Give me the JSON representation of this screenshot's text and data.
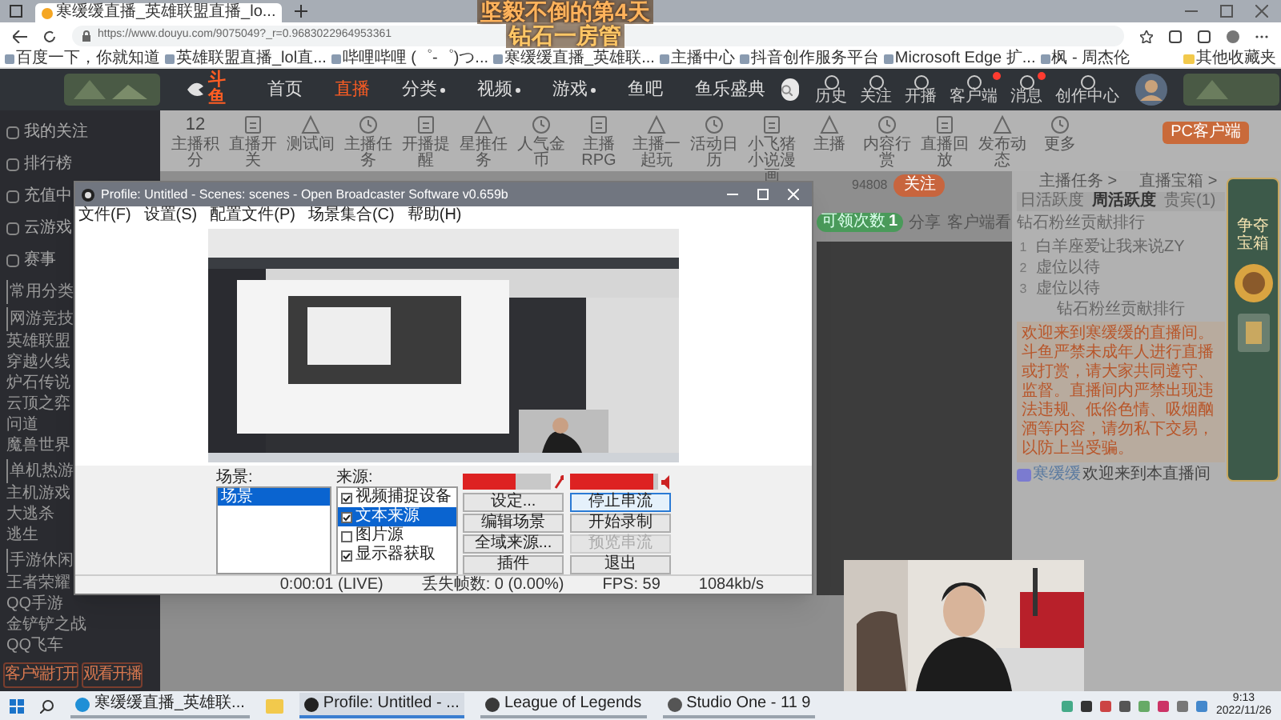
{
  "stream_overlay": [
    "坚毅不倒的第4天",
    "钻石一房管"
  ],
  "browser": {
    "tab_title": "寒缓缓直播_英雄联盟直播_lo...",
    "url": "https://www.douyu.com/9075049?_r=0.9683022964953361",
    "bookmarks": [
      "百度一下，你就知道",
      "英雄联盟直播_lol直...",
      "哔哩哔哩 (゜-゜)つ...",
      "寒缓缓直播_英雄联...",
      "主播中心",
      "抖音创作服务平台",
      "Microsoft Edge 扩...",
      "枫 - 周杰伦"
    ],
    "other_bookmarks": "其他收藏夹"
  },
  "site": {
    "logo": "斗鱼",
    "nav": [
      {
        "label": "首页",
        "selected": false,
        "has_menu": false
      },
      {
        "label": "直播",
        "selected": true,
        "has_menu": false
      },
      {
        "label": "分类",
        "selected": false,
        "has_menu": true
      },
      {
        "label": "视频",
        "selected": false,
        "has_menu": true
      },
      {
        "label": "游戏",
        "selected": false,
        "has_menu": true
      },
      {
        "label": "鱼吧",
        "selected": false,
        "has_menu": false
      },
      {
        "label": "鱼乐盛典",
        "selected": false,
        "has_menu": false
      }
    ],
    "top_icons": [
      {
        "label": "历史",
        "badge": false
      },
      {
        "label": "关注",
        "badge": false
      },
      {
        "label": "开播",
        "badge": false
      },
      {
        "label": "客户端",
        "badge": true
      },
      {
        "label": "消息",
        "badge": true
      },
      {
        "label": "创作中心",
        "badge": false
      }
    ],
    "score": "12",
    "toolbar": [
      "主播积分",
      "直播开关",
      "测试间",
      "主播任务",
      "开播提醒",
      "星推任务",
      "人气金币",
      "主播RPG",
      "主播一起玩",
      "活动日历",
      "小飞猪小说漫画",
      "主播",
      "内容行赏",
      "直播回放",
      "发布动态",
      "更多"
    ],
    "client_button": "PC客户端",
    "sidebar": [
      {
        "kind": "link",
        "label": "我的关注"
      },
      {
        "kind": "link",
        "label": "排行榜"
      },
      {
        "kind": "link",
        "label": "充值中"
      },
      {
        "kind": "link",
        "label": "云游戏"
      },
      {
        "kind": "link",
        "label": "赛事"
      },
      {
        "kind": "header",
        "label": "常用分类"
      },
      {
        "kind": "header",
        "label": "网游竞技"
      },
      {
        "kind": "item",
        "label": "英雄联盟"
      },
      {
        "kind": "item",
        "label": "穿越火线"
      },
      {
        "kind": "item",
        "label": "炉石传说"
      },
      {
        "kind": "item",
        "label": "云顶之弈"
      },
      {
        "kind": "item",
        "label": "问道"
      },
      {
        "kind": "item",
        "label": "魔兽世界"
      },
      {
        "kind": "header",
        "label": "单机热游"
      },
      {
        "kind": "item",
        "label": "主机游戏"
      },
      {
        "kind": "item",
        "label": "大逃杀"
      },
      {
        "kind": "item",
        "label": "逃生"
      },
      {
        "kind": "header",
        "label": "手游休闲"
      },
      {
        "kind": "item",
        "label": "王者荣耀"
      },
      {
        "kind": "item",
        "label": "QQ手游"
      },
      {
        "kind": "item",
        "label": "金铲铲之战"
      },
      {
        "kind": "item",
        "label": "QQ飞车"
      }
    ],
    "sidebar_buttons": [
      "客户端打开",
      "观看开播"
    ]
  },
  "obs": {
    "title": "Profile: Untitled - Scenes: scenes - Open Broadcaster Software v0.659b",
    "menu": [
      "文件(F)",
      "设置(S)",
      "配置文件(P)",
      "场景集合(C)",
      "帮助(H)"
    ],
    "scenes_label": "场景:",
    "scenes": [
      {
        "label": "场景",
        "selected": true
      }
    ],
    "sources_label": "来源:",
    "sources": [
      {
        "label": "视频捕捉设备",
        "checked": true,
        "selected": false
      },
      {
        "label": "文本来源",
        "checked": true,
        "selected": true
      },
      {
        "label": "图片源",
        "checked": false,
        "selected": false
      },
      {
        "label": "显示器获取",
        "checked": true,
        "selected": false
      }
    ],
    "meters": [
      {
        "kind": "microphone",
        "level": 0.6
      },
      {
        "kind": "speaker",
        "level": 0.95
      }
    ],
    "buttons": [
      {
        "label": "设定...",
        "disabled": false,
        "focused": false
      },
      {
        "label": "停止串流",
        "disabled": false,
        "focused": true
      },
      {
        "label": "编辑场景",
        "disabled": false,
        "focused": false
      },
      {
        "label": "开始录制",
        "disabled": false,
        "focused": false
      },
      {
        "label": "全域来源...",
        "disabled": false,
        "focused": false
      },
      {
        "label": "预览串流",
        "disabled": true,
        "focused": false
      },
      {
        "label": "插件",
        "disabled": false,
        "focused": false
      },
      {
        "label": "退出",
        "disabled": false,
        "focused": false
      }
    ],
    "status": [
      "0:00:01 (LIVE)",
      "丢失帧数: 0 (0.00%)",
      "FPS: 59",
      "1084kb/s"
    ]
  },
  "room": {
    "follower_count": "94808",
    "follow_button": "关注",
    "claim_label": "可领次数",
    "claim_count": "1",
    "share": "分享",
    "client_watch": "客户端看",
    "links": [
      "主播任务 >",
      "直播宝箱 >"
    ],
    "tabs": [
      {
        "label": "日活跃度",
        "selected": false
      },
      {
        "label": "周活跃度",
        "selected": true
      },
      {
        "label": "贵宾(1)",
        "selected": false
      }
    ],
    "rank_title": "钻石粉丝贡献排行",
    "rank_rows": [
      {
        "rank": "1",
        "name": "白羊座爱让我来说ZY"
      },
      {
        "rank": "2",
        "name": "虚位以待"
      },
      {
        "rank": "3",
        "name": "虚位以待"
      }
    ],
    "rank_footer": "钻石粉丝贡献排行",
    "notice": "欢迎来到寒缓缓的直播间。斗鱼严禁未成年人进行直播或打赏，请大家共同遵守、监督。直播间内严禁出现违法违规、低俗色情、吸烟酗酒等内容，请勿私下交易，以防上当受骗。",
    "chat": {
      "user": "寒缓缓",
      "text": "欢迎来到本直播间"
    },
    "ad_title": "争夺宝箱"
  },
  "taskbar": {
    "apps": [
      {
        "label": "寒缓缓直播_英雄联...",
        "active": false
      },
      {
        "label": "Profile: Untitled - ...",
        "active": true
      },
      {
        "label": "League of Legends",
        "active": false
      },
      {
        "label": "Studio One - 11 9",
        "active": false
      }
    ],
    "time": "9:13",
    "date": "2022/11/26"
  }
}
